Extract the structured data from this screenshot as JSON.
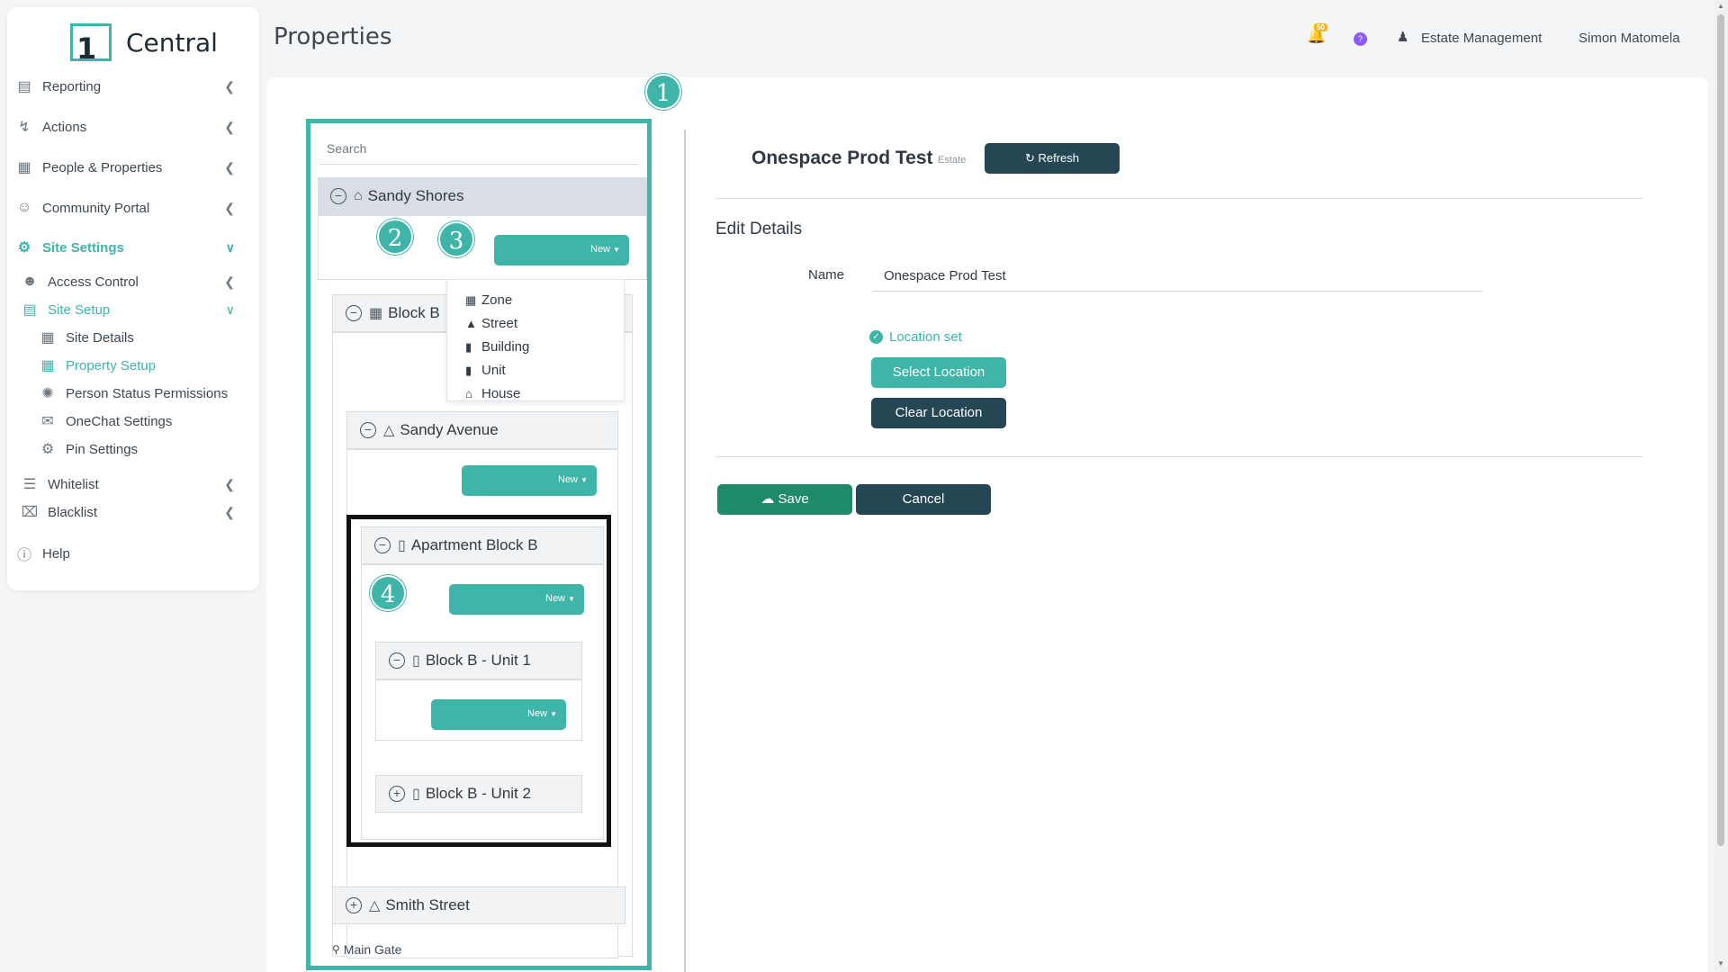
{
  "app": {
    "logo_number": "1",
    "logo_name": "Central",
    "page_title": "Properties"
  },
  "header": {
    "notification_count": "50",
    "help_badge": "?",
    "estate_label": "Estate Management",
    "user_name": "Simon Matomela"
  },
  "sidebar": {
    "items": [
      {
        "label": "Reporting"
      },
      {
        "label": "Actions"
      },
      {
        "label": "People & Properties"
      },
      {
        "label": "Community Portal"
      },
      {
        "label": "Site Settings"
      },
      {
        "label": "Access Control"
      },
      {
        "label": "Site Setup"
      },
      {
        "label": "Site Details"
      },
      {
        "label": "Property Setup"
      },
      {
        "label": "Person Status Permissions"
      },
      {
        "label": "OneChat Settings"
      },
      {
        "label": "Pin Settings"
      },
      {
        "label": "Whitelist"
      },
      {
        "label": "Blacklist"
      },
      {
        "label": "Help"
      }
    ]
  },
  "tree": {
    "search_placeholder": "Search",
    "new_label": "New",
    "nodes": {
      "root": "Sandy Shores",
      "block": "Block B",
      "street": "Sandy Avenue",
      "apartment": "Apartment Block B",
      "unit1": "Block B - Unit 1",
      "unit2": "Block B - Unit 2",
      "smith": "Smith Street",
      "gate": "Main Gate"
    },
    "new_menu": [
      "Zone",
      "Street",
      "Building",
      "Unit",
      "House"
    ]
  },
  "callouts": [
    "1",
    "2",
    "3",
    "4"
  ],
  "details": {
    "title": "Onespace Prod Test",
    "type": "Estate",
    "refresh_label": "Refresh",
    "section_title": "Edit Details",
    "name_label": "Name",
    "name_value": "Onespace Prod Test",
    "location_status": "Location set",
    "select_location_label": "Select Location",
    "clear_location_label": "Clear Location",
    "save_label": "Save",
    "cancel_label": "Cancel"
  },
  "colors": {
    "accent": "#3fb4a8",
    "dark": "#254653",
    "save": "#1f8a6a",
    "highlight_black": "#111111"
  }
}
